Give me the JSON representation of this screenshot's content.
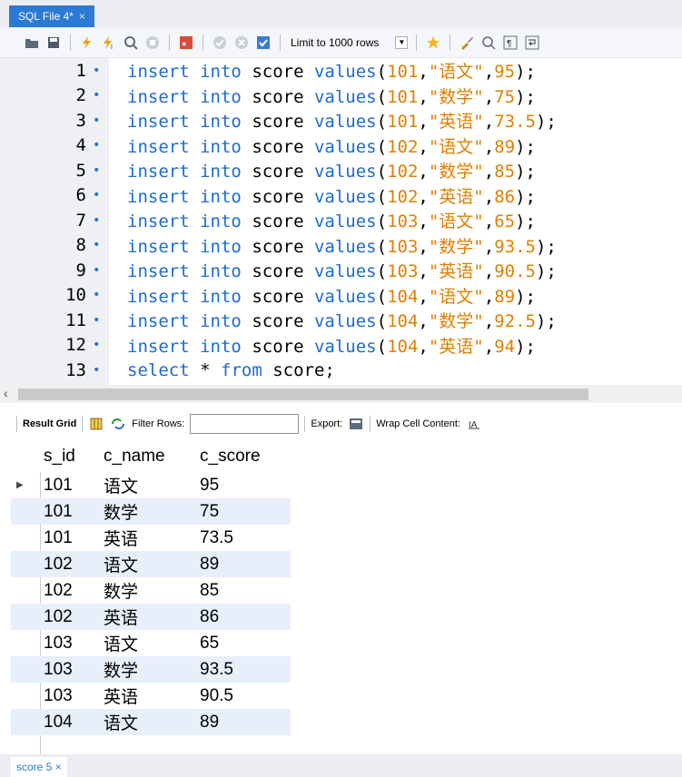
{
  "tab": {
    "title": "SQL File 4*",
    "close": "×"
  },
  "toolbar": {
    "limit_label": "Limit to 1000 rows"
  },
  "editor": {
    "lines": [
      {
        "num": "1",
        "sid": "101",
        "name": "\"语文\"",
        "score": "95"
      },
      {
        "num": "2",
        "sid": "101",
        "name": "\"数学\"",
        "score": "75"
      },
      {
        "num": "3",
        "sid": "101",
        "name": "\"英语\"",
        "score": "73.5"
      },
      {
        "num": "4",
        "sid": "102",
        "name": "\"语文\"",
        "score": "89"
      },
      {
        "num": "5",
        "sid": "102",
        "name": "\"数学\"",
        "score": "85"
      },
      {
        "num": "6",
        "sid": "102",
        "name": "\"英语\"",
        "score": "86"
      },
      {
        "num": "7",
        "sid": "103",
        "name": "\"语文\"",
        "score": "65"
      },
      {
        "num": "8",
        "sid": "103",
        "name": "\"数学\"",
        "score": "93.5"
      },
      {
        "num": "9",
        "sid": "103",
        "name": "\"英语\"",
        "score": "90.5"
      },
      {
        "num": "10",
        "sid": "104",
        "name": "\"语文\"",
        "score": "89"
      },
      {
        "num": "11",
        "sid": "104",
        "name": "\"数学\"",
        "score": "92.5"
      },
      {
        "num": "12",
        "sid": "104",
        "name": "\"英语\"",
        "score": "94"
      }
    ],
    "select_line": {
      "num": "13",
      "kw1": "select",
      "star": "*",
      "kw2": "from",
      "table": "score;"
    },
    "insert_kw": "insert",
    "into_kw": "into",
    "table": "score",
    "values_kw": "values"
  },
  "result_toolbar": {
    "result_grid": "Result Grid",
    "filter_rows": "Filter Rows:",
    "export": "Export:",
    "wrap": "Wrap Cell Content:"
  },
  "grid": {
    "headers": [
      "s_id",
      "c_name",
      "c_score"
    ],
    "rows": [
      [
        "101",
        "语文",
        "95"
      ],
      [
        "101",
        "数学",
        "75"
      ],
      [
        "101",
        "英语",
        "73.5"
      ],
      [
        "102",
        "语文",
        "89"
      ],
      [
        "102",
        "数学",
        "85"
      ],
      [
        "102",
        "英语",
        "86"
      ],
      [
        "103",
        "语文",
        "65"
      ],
      [
        "103",
        "数学",
        "93.5"
      ],
      [
        "103",
        "英语",
        "90.5"
      ],
      [
        "104",
        "语文",
        "89"
      ]
    ]
  },
  "bottom_tab": {
    "label": "score 5",
    "close": "×"
  },
  "colors": {
    "accent": "#2b7bd6",
    "keyword": "#1b6bd2",
    "literal": "#e07f00",
    "alt_row": "#e7effb"
  }
}
